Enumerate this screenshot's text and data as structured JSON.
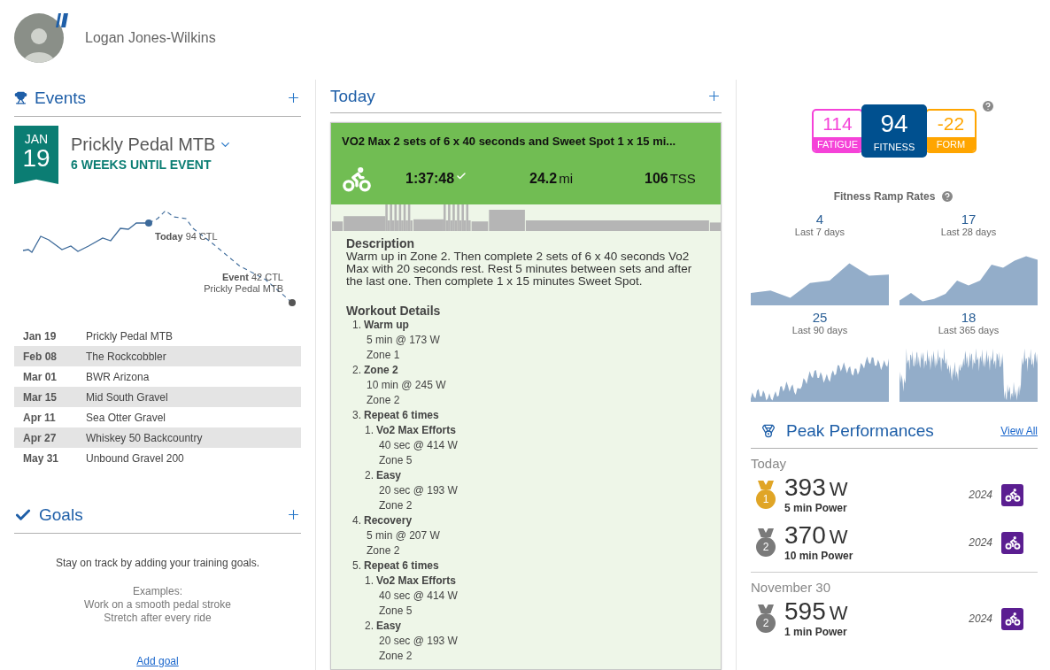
{
  "profile": {
    "name": "Logan Jones-Wilkins"
  },
  "events": {
    "title": "Events",
    "featured": {
      "month": "JAN",
      "day": "19",
      "name": "Prickly Pedal MTB",
      "countdown": "6 WEEKS UNTIL EVENT",
      "today_label": "**Today** 94 CTL",
      "event_label": "**Event** 42 CTL",
      "event_name": "Prickly Pedal MTB"
    },
    "list": [
      {
        "date": "Jan 19",
        "name": "Prickly Pedal MTB"
      },
      {
        "date": "Feb 08",
        "name": "The Rockcobbler"
      },
      {
        "date": "Mar 01",
        "name": "BWR Arizona"
      },
      {
        "date": "Mar 15",
        "name": "Mid South Gravel"
      },
      {
        "date": "Apr 11",
        "name": "Sea Otter Gravel"
      },
      {
        "date": "Apr 27",
        "name": "Whiskey 50 Backcountry"
      },
      {
        "date": "May 31",
        "name": "Unbound Gravel 200"
      }
    ]
  },
  "goals": {
    "title": "Goals",
    "message": "Stay on track by adding your training goals.",
    "examples_title": "Examples:",
    "examples": [
      "Work on a smooth pedal stroke",
      "Stretch after every ride"
    ],
    "link": "Add goal"
  },
  "today": {
    "title": "Today",
    "workout": {
      "title": "VO2 Max 2 sets of 6 x 40 seconds and Sweet Spot 1 x 15 mi...",
      "completed": true,
      "duration": "1:37:48",
      "distance": {
        "value": "24.2",
        "unit": "mi"
      },
      "tss": {
        "value": "106",
        "unit": "TSS"
      },
      "description_title": "Description",
      "description": "Warm up in Zone 2. Then complete 2 sets of 6 x 40 seconds Vo2 Max with 20 seconds rest. Rest 5 minutes between sets and after the last one. Then complete 1 x 15 minutes Sweet Spot.",
      "details_title": "Workout Details",
      "steps": [
        {
          "number": "1.",
          "title": "Warm up",
          "lines": [
            "5 min @ 173 W",
            "Zone 1"
          ]
        },
        {
          "number": "2.",
          "title": "Zone 2",
          "lines": [
            "10 min @ 245 W",
            "Zone 2"
          ]
        },
        {
          "number": "3.",
          "title": "Repeat 6 times",
          "children": [
            {
              "number": "1.",
              "title": "Vo2 Max Efforts",
              "lines": [
                "40 sec @ 414 W",
                "Zone 5"
              ]
            },
            {
              "number": "2.",
              "title": "Easy",
              "lines": [
                "20 sec @ 193 W",
                "Zone 2"
              ]
            }
          ]
        },
        {
          "number": "4.",
          "title": "Recovery",
          "lines": [
            "5 min @ 207 W",
            "Zone 2"
          ]
        },
        {
          "number": "5.",
          "title": "Repeat 6 times",
          "children": [
            {
              "number": "1.",
              "title": "Vo2 Max Efforts",
              "lines": [
                "40 sec @ 414 W",
                "Zone 5"
              ]
            },
            {
              "number": "2.",
              "title": "Easy",
              "lines": [
                "20 sec @ 193 W",
                "Zone 2"
              ]
            }
          ]
        }
      ]
    }
  },
  "metrics": [
    {
      "kind": "side",
      "value": "114",
      "label": "FATIGUE",
      "color": "#f542d8"
    },
    {
      "kind": "main",
      "value": "94",
      "label": "FITNESS",
      "color": "#00508f"
    },
    {
      "kind": "side",
      "value": "-22",
      "label": "FORM",
      "color": "#ffa500"
    }
  ],
  "ramp_rates": {
    "title": "Fitness Ramp Rates",
    "items": [
      {
        "value": "4",
        "label": "Last 7 days"
      },
      {
        "value": "17",
        "label": "Last 28 days"
      },
      {
        "value": "25",
        "label": "Last 90 days"
      },
      {
        "value": "18",
        "label": "Last 365 days"
      }
    ]
  },
  "peak_performances": {
    "title": "Peak Performances",
    "link": "View All",
    "groups": [
      {
        "date": "Today",
        "items": [
          {
            "rank": "1",
            "color": "#e0a526",
            "value": "393",
            "unit": "W",
            "label": "5 min Power",
            "year": "2024"
          },
          {
            "rank": "2",
            "color": "#7a7a7a",
            "value": "370",
            "unit": "W",
            "label": "10 min Power",
            "year": "2024"
          }
        ]
      },
      {
        "date": "November 30",
        "items": [
          {
            "rank": "2",
            "color": "#7a7a7a",
            "value": "595",
            "unit": "W",
            "label": "1 min Power",
            "year": "2024"
          }
        ]
      }
    ]
  }
}
